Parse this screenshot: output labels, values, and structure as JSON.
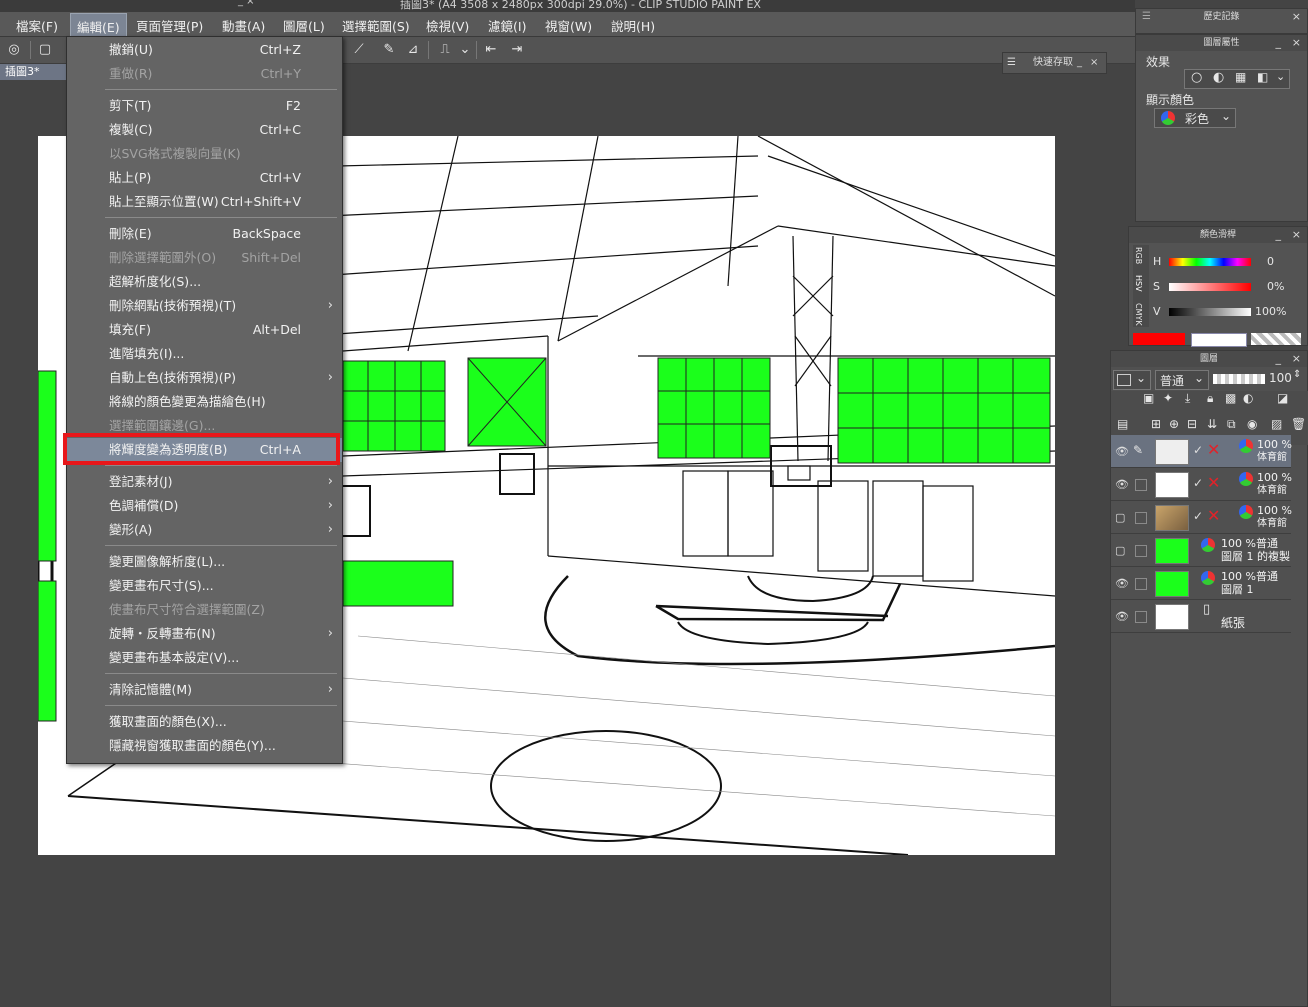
{
  "window": {
    "title": "插圖3* (A4 3508 x 2480px 300dpi 29.0%)  - CLIP STUDIO PAINT EX",
    "mini_controls": "_  ×"
  },
  "menubar": {
    "items": [
      "檔案(F)",
      "編輯(E)",
      "頁面管理(P)",
      "動畫(A)",
      "圖層(L)",
      "選擇範圍(S)",
      "檢視(V)",
      "濾鏡(I)",
      "視窗(W)",
      "說明(H)"
    ],
    "active_index": 1
  },
  "canvas_tab": {
    "label": "插圖3*"
  },
  "quick_save": {
    "label": "快速存取",
    "minimize": "_",
    "close": "×",
    "grip": "☰"
  },
  "edit_menu": {
    "items": [
      {
        "label": "撤銷(U)",
        "shortcut": "Ctrl+Z",
        "disabled": false,
        "submenu": false
      },
      {
        "label": "重做(R)",
        "shortcut": "Ctrl+Y",
        "disabled": true,
        "submenu": false
      },
      {
        "label": "剪下(T)",
        "shortcut": "F2",
        "disabled": false,
        "submenu": false
      },
      {
        "label": "複製(C)",
        "shortcut": "Ctrl+C",
        "disabled": false,
        "submenu": false
      },
      {
        "label": "以SVG格式複製向量(K)",
        "shortcut": "",
        "disabled": true,
        "submenu": false
      },
      {
        "label": "貼上(P)",
        "shortcut": "Ctrl+V",
        "disabled": false,
        "submenu": false
      },
      {
        "label": "貼上至顯示位置(W)",
        "shortcut": "Ctrl+Shift+V",
        "disabled": false,
        "submenu": false
      },
      {
        "label": "刪除(E)",
        "shortcut": "BackSpace",
        "disabled": false,
        "submenu": false
      },
      {
        "label": "刪除選擇範圍外(O)",
        "shortcut": "Shift+Del",
        "disabled": true,
        "submenu": false
      },
      {
        "label": "超解析度化(S)...",
        "shortcut": "",
        "disabled": false,
        "submenu": false
      },
      {
        "label": "刪除網點(技術預視)(T)",
        "shortcut": "",
        "disabled": false,
        "submenu": true
      },
      {
        "label": "填充(F)",
        "shortcut": "Alt+Del",
        "disabled": false,
        "submenu": false
      },
      {
        "label": "進階填充(I)...",
        "shortcut": "",
        "disabled": false,
        "submenu": false
      },
      {
        "label": "自動上色(技術預視)(P)",
        "shortcut": "",
        "disabled": false,
        "submenu": true
      },
      {
        "label": "將線的顏色變更為描繪色(H)",
        "shortcut": "",
        "disabled": false,
        "submenu": false
      },
      {
        "label": "選擇範圍鑲邊(G)...",
        "shortcut": "",
        "disabled": true,
        "submenu": false
      },
      {
        "label": "將輝度變為透明度(B)",
        "shortcut": "Ctrl+A",
        "disabled": false,
        "submenu": false,
        "highlighted": true
      },
      {
        "label": "登記素材(J)",
        "shortcut": "",
        "disabled": false,
        "submenu": true
      },
      {
        "label": "色調補償(D)",
        "shortcut": "",
        "disabled": false,
        "submenu": true
      },
      {
        "label": "變形(A)",
        "shortcut": "",
        "disabled": false,
        "submenu": true
      },
      {
        "label": "變更圖像解析度(L)...",
        "shortcut": "",
        "disabled": false,
        "submenu": false
      },
      {
        "label": "變更畫布尺寸(S)...",
        "shortcut": "",
        "disabled": false,
        "submenu": false
      },
      {
        "label": "使畫布尺寸符合選擇範圍(Z)",
        "shortcut": "",
        "disabled": true,
        "submenu": false
      },
      {
        "label": "旋轉・反轉畫布(N)",
        "shortcut": "",
        "disabled": false,
        "submenu": true
      },
      {
        "label": "變更畫布基本設定(V)...",
        "shortcut": "",
        "disabled": false,
        "submenu": false
      },
      {
        "label": "清除記憶體(M)",
        "shortcut": "",
        "disabled": false,
        "submenu": true
      },
      {
        "label": "獲取畫面的顏色(X)...",
        "shortcut": "",
        "disabled": false,
        "submenu": false
      },
      {
        "label": "隱藏視窗獲取畫面的顏色(Y)...",
        "shortcut": "",
        "disabled": false,
        "submenu": false
      }
    ]
  },
  "history_panel": {
    "title": "歷史記錄"
  },
  "layer_property_panel": {
    "title": "圖層屬性",
    "effect_label": "效果",
    "display_color_label": "顯示顏色",
    "display_color_value": "彩色"
  },
  "color_slider_panel": {
    "title": "顏色滑桿",
    "tabs": [
      "RGB",
      "HSV",
      "CMYK"
    ],
    "rows": [
      {
        "label": "H",
        "value": "0"
      },
      {
        "label": "S",
        "value": "0%"
      },
      {
        "label": "V",
        "value": "100%"
      }
    ],
    "main_color": "#ff0000"
  },
  "layer_panel": {
    "title": "圖層",
    "blend_mode": "普通",
    "opacity": "100",
    "layers": [
      {
        "line1": "100 %",
        "line2": "体育館",
        "selected": true,
        "thumb": "white"
      },
      {
        "line1": "100 %",
        "line2": "体育館",
        "selected": false,
        "thumb": "white"
      },
      {
        "line1": "100 %",
        "line2": "体育館",
        "selected": false,
        "thumb": "photo"
      },
      {
        "line1": "100 %普通",
        "line2": "圖層 1 的複製",
        "selected": false,
        "thumb": "green"
      },
      {
        "line1": "100 %普通",
        "line2": "圖層 1",
        "selected": false,
        "thumb": "green"
      },
      {
        "line1": "",
        "line2": "紙張",
        "selected": false,
        "thumb": "paper"
      }
    ]
  },
  "colors": {
    "highlight_frame": "#e8171a",
    "window_green": "#1bff1b"
  }
}
